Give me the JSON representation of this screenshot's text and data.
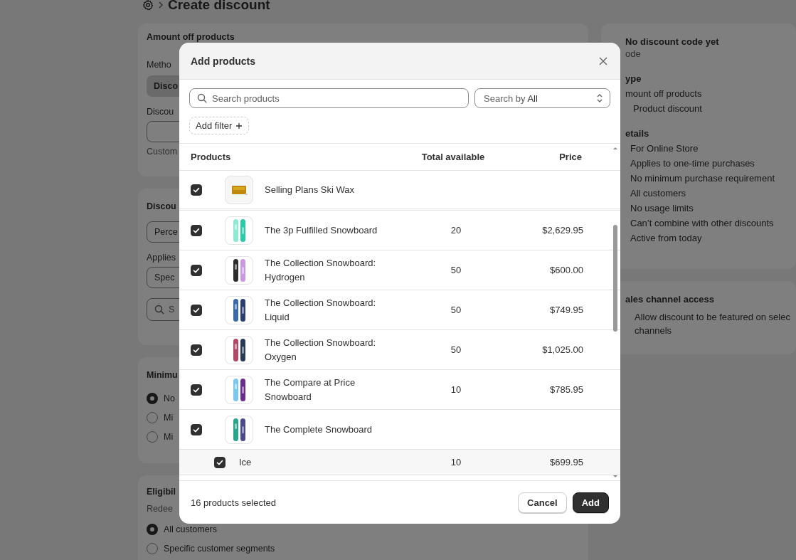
{
  "header": {
    "title": "Create discount"
  },
  "amount_card": {
    "title": "Amount off products",
    "method_label": "Metho",
    "method_options": [
      {
        "label": "Disco",
        "selected": true
      }
    ],
    "code_label": "Discou",
    "help": "Custom"
  },
  "value_card": {
    "title": "Discou",
    "value_select": "Perce",
    "applies_label": "Applies",
    "applies_select": "Spec",
    "search": {
      "placeholder": "S"
    }
  },
  "minimum_card": {
    "title": "Minimu",
    "options": [
      {
        "label": "No",
        "selected": true
      },
      {
        "label": "Mi",
        "selected": false
      },
      {
        "label": "Mi",
        "selected": false
      }
    ]
  },
  "eligibility_card": {
    "title": "Eligibil",
    "label": "Redee",
    "options": [
      {
        "label": "All customers",
        "selected": true
      },
      {
        "label": "Specific customer segments",
        "selected": false
      }
    ]
  },
  "summary": {
    "code_title": "No discount code yet",
    "code_subtitle": "ode",
    "type_heading": "ype",
    "type_items": [
      "mount off products",
      "Product discount"
    ],
    "details_heading": "etails",
    "details": [
      "For Online Store",
      "Applies to one-time purchases",
      "No minimum purchase requirement",
      "All customers",
      "No usage limits",
      "Can’t combine with other discounts",
      "Active from today"
    ],
    "sales_heading": "ales channel access",
    "sales_option_lines": [
      "Allow discount to be featured on selec",
      "channels"
    ]
  },
  "modal": {
    "title": "Add products",
    "search": {
      "placeholder": "Search products"
    },
    "search_by": {
      "prefix": "Search by",
      "value": "All"
    },
    "add_filter": "Add filter",
    "columns": [
      "Products",
      "Total available",
      "Price"
    ],
    "rows": [
      {
        "kind": "product",
        "checked": true,
        "name": "Selling Plans Ski Wax"
      },
      {
        "kind": "product",
        "checked": true,
        "name": "The 3p Fulfilled Snowboard",
        "available": "20",
        "price": "$2,629.95"
      },
      {
        "kind": "product",
        "checked": true,
        "name": "The Collection Snowboard: Hydrogen",
        "available": "50",
        "price": "$600.00"
      },
      {
        "kind": "product",
        "checked": true,
        "name": "The Collection Snowboard: Liquid",
        "available": "50",
        "price": "$749.95"
      },
      {
        "kind": "product",
        "checked": true,
        "name": "The Collection Snowboard: Oxygen",
        "available": "50",
        "price": "$1,025.00"
      },
      {
        "kind": "product",
        "checked": true,
        "name": "The Compare at Price Snowboard",
        "available": "10",
        "price": "$785.95"
      },
      {
        "kind": "product",
        "checked": true,
        "name": "The Complete Snowboard"
      },
      {
        "kind": "variant",
        "checked": true,
        "name": "Ice",
        "available": "10",
        "price": "$699.95"
      }
    ],
    "selected_count": "16 products selected",
    "buttons": [
      "Cancel",
      "Add"
    ]
  }
}
